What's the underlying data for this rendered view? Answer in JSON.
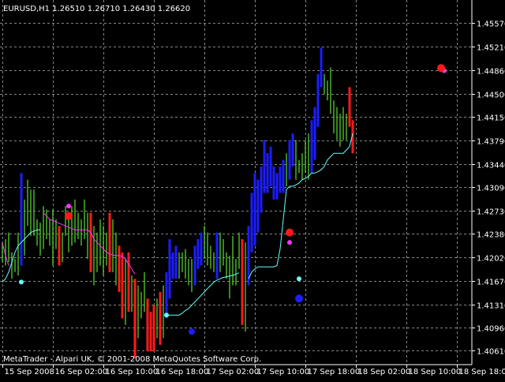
{
  "chart_data": {
    "type": "candlestick",
    "symbol_header": "EURUSD,H1  1.26510 1.26710 1.26430 1.26620",
    "footer": "MetaTrader - Alpari UK, © 2001-2008 MetaQuotes Software Corp.",
    "ylim": [
      1.404,
      1.4592
    ],
    "grid": true,
    "y_ticks": [
      "1.45570",
      "1.45210",
      "1.44860",
      "1.44500",
      "1.44150",
      "1.43790",
      "1.43440",
      "1.43090",
      "1.42730",
      "1.42380",
      "1.42020",
      "1.41670",
      "1.41310",
      "1.40960",
      "1.40610"
    ],
    "x_ticks": [
      {
        "label": "15 Sep 2008",
        "bar": 0
      },
      {
        "label": "16 Sep 02:00",
        "bar": 16
      },
      {
        "label": "16 Sep 10:00",
        "bar": 32
      },
      {
        "label": "16 Sep 18:00",
        "bar": 48
      },
      {
        "label": "17 Sep 02:00",
        "bar": 64
      },
      {
        "label": "17 Sep 10:00",
        "bar": 80
      },
      {
        "label": "17 Sep 18:00",
        "bar": 96
      },
      {
        "label": "18 Sep 02:00",
        "bar": 112
      },
      {
        "label": "18 Sep 10:00",
        "bar": 128
      },
      {
        "label": "18 Sep 18:00",
        "bar": 144
      }
    ],
    "colors": {
      "background": "#000000",
      "grid": "#7f8a7f",
      "neutral_bar": "#4fbf2a",
      "bull_bar": "#1d1dff",
      "bear_bar": "#ff1a1a",
      "trail_line": "#66ffff",
      "down_trail_line": "#ff33ff",
      "dot_red": "#ff1a1a",
      "dot_magenta": "#ff33ff",
      "dot_blue": "#1d1dff",
      "dot_cyan": "#66ffff",
      "text": "#ffffff"
    },
    "bars": [
      {
        "h": 1.4225,
        "l": 1.4195,
        "c": "g"
      },
      {
        "h": 1.423,
        "l": 1.419,
        "c": "g"
      },
      {
        "h": 1.424,
        "l": 1.4195,
        "c": "g"
      },
      {
        "h": 1.421,
        "l": 1.417,
        "c": "g"
      },
      {
        "h": 1.42,
        "l": 1.418,
        "c": "g"
      },
      {
        "h": 1.424,
        "l": 1.4175,
        "c": "g"
      },
      {
        "h": 1.433,
        "l": 1.419,
        "c": "b"
      },
      {
        "h": 1.429,
        "l": 1.4205,
        "c": "g"
      },
      {
        "h": 1.432,
        "l": 1.425,
        "c": "g"
      },
      {
        "h": 1.4305,
        "l": 1.4235,
        "c": "g"
      },
      {
        "h": 1.4305,
        "l": 1.4235,
        "c": "g"
      },
      {
        "h": 1.426,
        "l": 1.422,
        "c": "g"
      },
      {
        "h": 1.4255,
        "l": 1.4205,
        "c": "g"
      },
      {
        "h": 1.428,
        "l": 1.4215,
        "c": "g"
      },
      {
        "h": 1.4275,
        "l": 1.423,
        "c": "g"
      },
      {
        "h": 1.426,
        "l": 1.422,
        "c": "g"
      },
      {
        "h": 1.4275,
        "l": 1.419,
        "c": "g"
      },
      {
        "h": 1.426,
        "l": 1.4215,
        "c": "g"
      },
      {
        "h": 1.425,
        "l": 1.419,
        "c": "r"
      },
      {
        "h": 1.424,
        "l": 1.4195,
        "c": "g"
      },
      {
        "h": 1.428,
        "l": 1.4235,
        "c": "g"
      },
      {
        "h": 1.427,
        "l": 1.421,
        "c": "g"
      },
      {
        "h": 1.428,
        "l": 1.422,
        "c": "g"
      },
      {
        "h": 1.429,
        "l": 1.4225,
        "c": "g"
      },
      {
        "h": 1.427,
        "l": 1.423,
        "c": "g"
      },
      {
        "h": 1.426,
        "l": 1.422,
        "c": "g"
      },
      {
        "h": 1.429,
        "l": 1.423,
        "c": "g"
      },
      {
        "h": 1.427,
        "l": 1.42,
        "c": "g"
      },
      {
        "h": 1.427,
        "l": 1.418,
        "c": "r"
      },
      {
        "h": 1.425,
        "l": 1.416,
        "c": "g"
      },
      {
        "h": 1.424,
        "l": 1.418,
        "c": "g"
      },
      {
        "h": 1.426,
        "l": 1.419,
        "c": "g"
      },
      {
        "h": 1.425,
        "l": 1.4175,
        "c": "g"
      },
      {
        "h": 1.424,
        "l": 1.419,
        "c": "g"
      },
      {
        "h": 1.427,
        "l": 1.418,
        "c": "r"
      },
      {
        "h": 1.426,
        "l": 1.418,
        "c": "g"
      },
      {
        "h": 1.424,
        "l": 1.416,
        "c": "g"
      },
      {
        "h": 1.422,
        "l": 1.415,
        "c": "r"
      },
      {
        "h": 1.421,
        "l": 1.411,
        "c": "r"
      },
      {
        "h": 1.42,
        "l": 1.41,
        "c": "g"
      },
      {
        "h": 1.421,
        "l": 1.412,
        "c": "r"
      },
      {
        "h": 1.4175,
        "l": 1.412,
        "c": "g"
      },
      {
        "h": 1.417,
        "l": 1.405,
        "c": "r"
      },
      {
        "h": 1.416,
        "l": 1.408,
        "c": "g"
      },
      {
        "h": 1.415,
        "l": 1.411,
        "c": "g"
      },
      {
        "h": 1.418,
        "l": 1.412,
        "c": "g"
      },
      {
        "h": 1.414,
        "l": 1.406,
        "c": "r"
      },
      {
        "h": 1.412,
        "l": 1.406,
        "c": "r"
      },
      {
        "h": 1.413,
        "l": 1.406,
        "c": "r"
      },
      {
        "h": 1.414,
        "l": 1.408,
        "c": "g"
      },
      {
        "h": 1.415,
        "l": 1.407,
        "c": "r"
      },
      {
        "h": 1.416,
        "l": 1.408,
        "c": "g"
      },
      {
        "h": 1.418,
        "l": 1.411,
        "c": "b"
      },
      {
        "h": 1.423,
        "l": 1.414,
        "c": "b"
      },
      {
        "h": 1.421,
        "l": 1.417,
        "c": "b"
      },
      {
        "h": 1.422,
        "l": 1.417,
        "c": "b"
      },
      {
        "h": 1.421,
        "l": 1.417,
        "c": "g"
      },
      {
        "h": 1.421,
        "l": 1.418,
        "c": "g"
      },
      {
        "h": 1.4215,
        "l": 1.417,
        "c": "g"
      },
      {
        "h": 1.42,
        "l": 1.416,
        "c": "g"
      },
      {
        "h": 1.42,
        "l": 1.415,
        "c": "g"
      },
      {
        "h": 1.422,
        "l": 1.416,
        "c": "b"
      },
      {
        "h": 1.423,
        "l": 1.4185,
        "c": "b"
      },
      {
        "h": 1.424,
        "l": 1.419,
        "c": "b"
      },
      {
        "h": 1.425,
        "l": 1.42,
        "c": "g"
      },
      {
        "h": 1.424,
        "l": 1.419,
        "c": "g"
      },
      {
        "h": 1.422,
        "l": 1.4185,
        "c": "g"
      },
      {
        "h": 1.421,
        "l": 1.418,
        "c": "g"
      },
      {
        "h": 1.424,
        "l": 1.417,
        "c": "b"
      },
      {
        "h": 1.424,
        "l": 1.418,
        "c": "g"
      },
      {
        "h": 1.423,
        "l": 1.419,
        "c": "g"
      },
      {
        "h": 1.421,
        "l": 1.417,
        "c": "g"
      },
      {
        "h": 1.4205,
        "l": 1.414,
        "c": "g"
      },
      {
        "h": 1.4235,
        "l": 1.416,
        "c": "g"
      },
      {
        "h": 1.42,
        "l": 1.416,
        "c": "g"
      },
      {
        "h": 1.424,
        "l": 1.4185,
        "c": "g"
      },
      {
        "h": 1.423,
        "l": 1.41,
        "c": "r"
      },
      {
        "h": 1.4225,
        "l": 1.409,
        "c": "g"
      },
      {
        "h": 1.425,
        "l": 1.416,
        "c": "b"
      },
      {
        "h": 1.43,
        "l": 1.421,
        "c": "b"
      },
      {
        "h": 1.433,
        "l": 1.422,
        "c": "b"
      },
      {
        "h": 1.432,
        "l": 1.424,
        "c": "b"
      },
      {
        "h": 1.434,
        "l": 1.427,
        "c": "b"
      },
      {
        "h": 1.438,
        "l": 1.43,
        "c": "b"
      },
      {
        "h": 1.436,
        "l": 1.43,
        "c": "b"
      },
      {
        "h": 1.437,
        "l": 1.431,
        "c": "b"
      },
      {
        "h": 1.434,
        "l": 1.429,
        "c": "b"
      },
      {
        "h": 1.433,
        "l": 1.429,
        "c": "b"
      },
      {
        "h": 1.434,
        "l": 1.43,
        "c": "b"
      },
      {
        "h": 1.435,
        "l": 1.43,
        "c": "b"
      },
      {
        "h": 1.436,
        "l": 1.431,
        "c": "g"
      },
      {
        "h": 1.438,
        "l": 1.432,
        "c": "b"
      },
      {
        "h": 1.439,
        "l": 1.434,
        "c": "b"
      },
      {
        "h": 1.438,
        "l": 1.432,
        "c": "g"
      },
      {
        "h": 1.435,
        "l": 1.433,
        "c": "g"
      },
      {
        "h": 1.436,
        "l": 1.432,
        "c": "g"
      },
      {
        "h": 1.438,
        "l": 1.433,
        "c": "g"
      },
      {
        "h": 1.439,
        "l": 1.432,
        "c": "g"
      },
      {
        "h": 1.441,
        "l": 1.433,
        "c": "b"
      },
      {
        "h": 1.443,
        "l": 1.435,
        "c": "b"
      },
      {
        "h": 1.448,
        "l": 1.44,
        "c": "b"
      },
      {
        "h": 1.452,
        "l": 1.446,
        "c": "b"
      },
      {
        "h": 1.448,
        "l": 1.445,
        "c": "g"
      },
      {
        "h": 1.447,
        "l": 1.444,
        "c": "g"
      },
      {
        "h": 1.449,
        "l": 1.442,
        "c": "g"
      },
      {
        "h": 1.444,
        "l": 1.439,
        "c": "g"
      },
      {
        "h": 1.443,
        "l": 1.438,
        "c": "g"
      },
      {
        "h": 1.442,
        "l": 1.437,
        "c": "g"
      },
      {
        "h": 1.443,
        "l": 1.438,
        "c": "g"
      },
      {
        "h": 1.442,
        "l": 1.438,
        "c": "g"
      },
      {
        "h": 1.446,
        "l": 1.44,
        "c": "r"
      },
      {
        "h": 1.441,
        "l": 1.436,
        "c": "r"
      }
    ],
    "trail_down": [
      1.4225,
      1.4205,
      1.419,
      null,
      null,
      null,
      null,
      null,
      null,
      null,
      null,
      null,
      null,
      1.427,
      1.4265,
      1.426,
      1.4258,
      1.4256,
      1.4254,
      1.4252,
      1.425,
      1.4248,
      1.4246,
      1.4244,
      1.4244,
      1.4244,
      1.4244,
      1.4244,
      1.424,
      1.423,
      1.4225,
      1.422,
      1.4215,
      1.421,
      1.4208,
      1.4206,
      1.4205,
      1.4205,
      1.4204,
      1.42,
      1.4192,
      1.4185,
      1.4177
    ],
    "trail_up_segments": [
      {
        "start": 0,
        "values": [
          1.4165,
          1.417,
          1.418,
          1.4195,
          1.421,
          1.422,
          1.4225,
          1.423,
          1.4235,
          1.424,
          1.4242,
          1.4244,
          1.4244
        ]
      },
      {
        "start": 52,
        "values": [
          1.4115,
          1.4115,
          1.4115,
          1.4115,
          1.4115,
          1.4118,
          1.4122,
          1.4125,
          1.413,
          1.4135,
          1.414,
          1.4145,
          1.415,
          1.4155,
          1.416,
          1.4165,
          1.4168,
          1.417,
          1.4172,
          1.4173,
          1.4174,
          1.4175,
          1.4177,
          1.4179
        ]
      },
      {
        "start": 78,
        "values": [
          1.417,
          1.418,
          1.4185,
          1.4188,
          1.4188,
          1.4188,
          1.4188,
          1.4188,
          1.4188,
          1.419,
          1.4215,
          1.426,
          1.4305,
          1.431,
          1.431,
          1.4312,
          1.4315,
          1.432,
          1.4322,
          1.4325,
          1.433,
          1.433,
          1.4332,
          1.4335,
          1.434,
          1.435,
          1.4355,
          1.436,
          1.436,
          1.436,
          1.436,
          1.4365,
          1.437,
          1.439
        ]
      }
    ],
    "dots": [
      {
        "bar": 6,
        "value": 1.4165,
        "color": "dot_cyan",
        "r": 3
      },
      {
        "bar": 21,
        "value": 1.428,
        "color": "dot_magenta",
        "r": 3
      },
      {
        "bar": 21,
        "value": 1.4265,
        "color": "dot_red",
        "r": 5
      },
      {
        "bar": 52,
        "value": 1.4115,
        "color": "dot_cyan",
        "r": 3
      },
      {
        "bar": 60,
        "value": 1.409,
        "color": "dot_blue",
        "r": 4
      },
      {
        "bar": 91,
        "value": 1.4225,
        "color": "dot_magenta",
        "r": 3
      },
      {
        "bar": 91,
        "value": 1.424,
        "color": "dot_red",
        "r": 5
      },
      {
        "bar": 94,
        "value": 1.417,
        "color": "dot_cyan",
        "r": 3
      },
      {
        "bar": 94,
        "value": 1.414,
        "color": "dot_blue",
        "r": 5
      },
      {
        "bar": 140,
        "value": 1.4485,
        "color": "dot_magenta",
        "r": 3
      },
      {
        "bar": 139,
        "value": 1.4489,
        "color": "dot_red",
        "r": 5
      }
    ]
  }
}
